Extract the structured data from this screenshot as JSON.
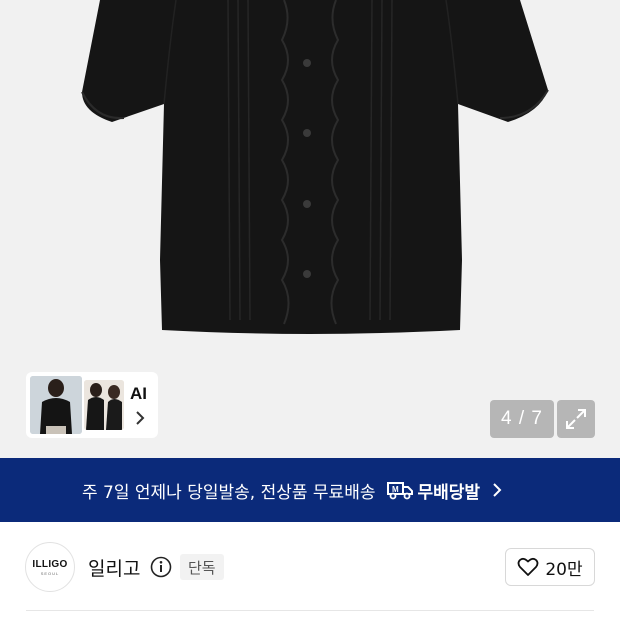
{
  "gallery": {
    "ai_label": "AI",
    "counter": "4 / 7"
  },
  "banner": {
    "text": "주 7일 언제나 당일발송, 전상품 무료배송",
    "badge_label": "무배당발",
    "badge_icon": "delivery-truck-icon",
    "color": "#0b2a7a"
  },
  "brand": {
    "logo_text": "ILLIGO",
    "logo_sub": "SEOUL",
    "name": "일리고",
    "tag": "단독"
  },
  "like": {
    "count": "20만",
    "icon": "heart-outline-icon"
  }
}
